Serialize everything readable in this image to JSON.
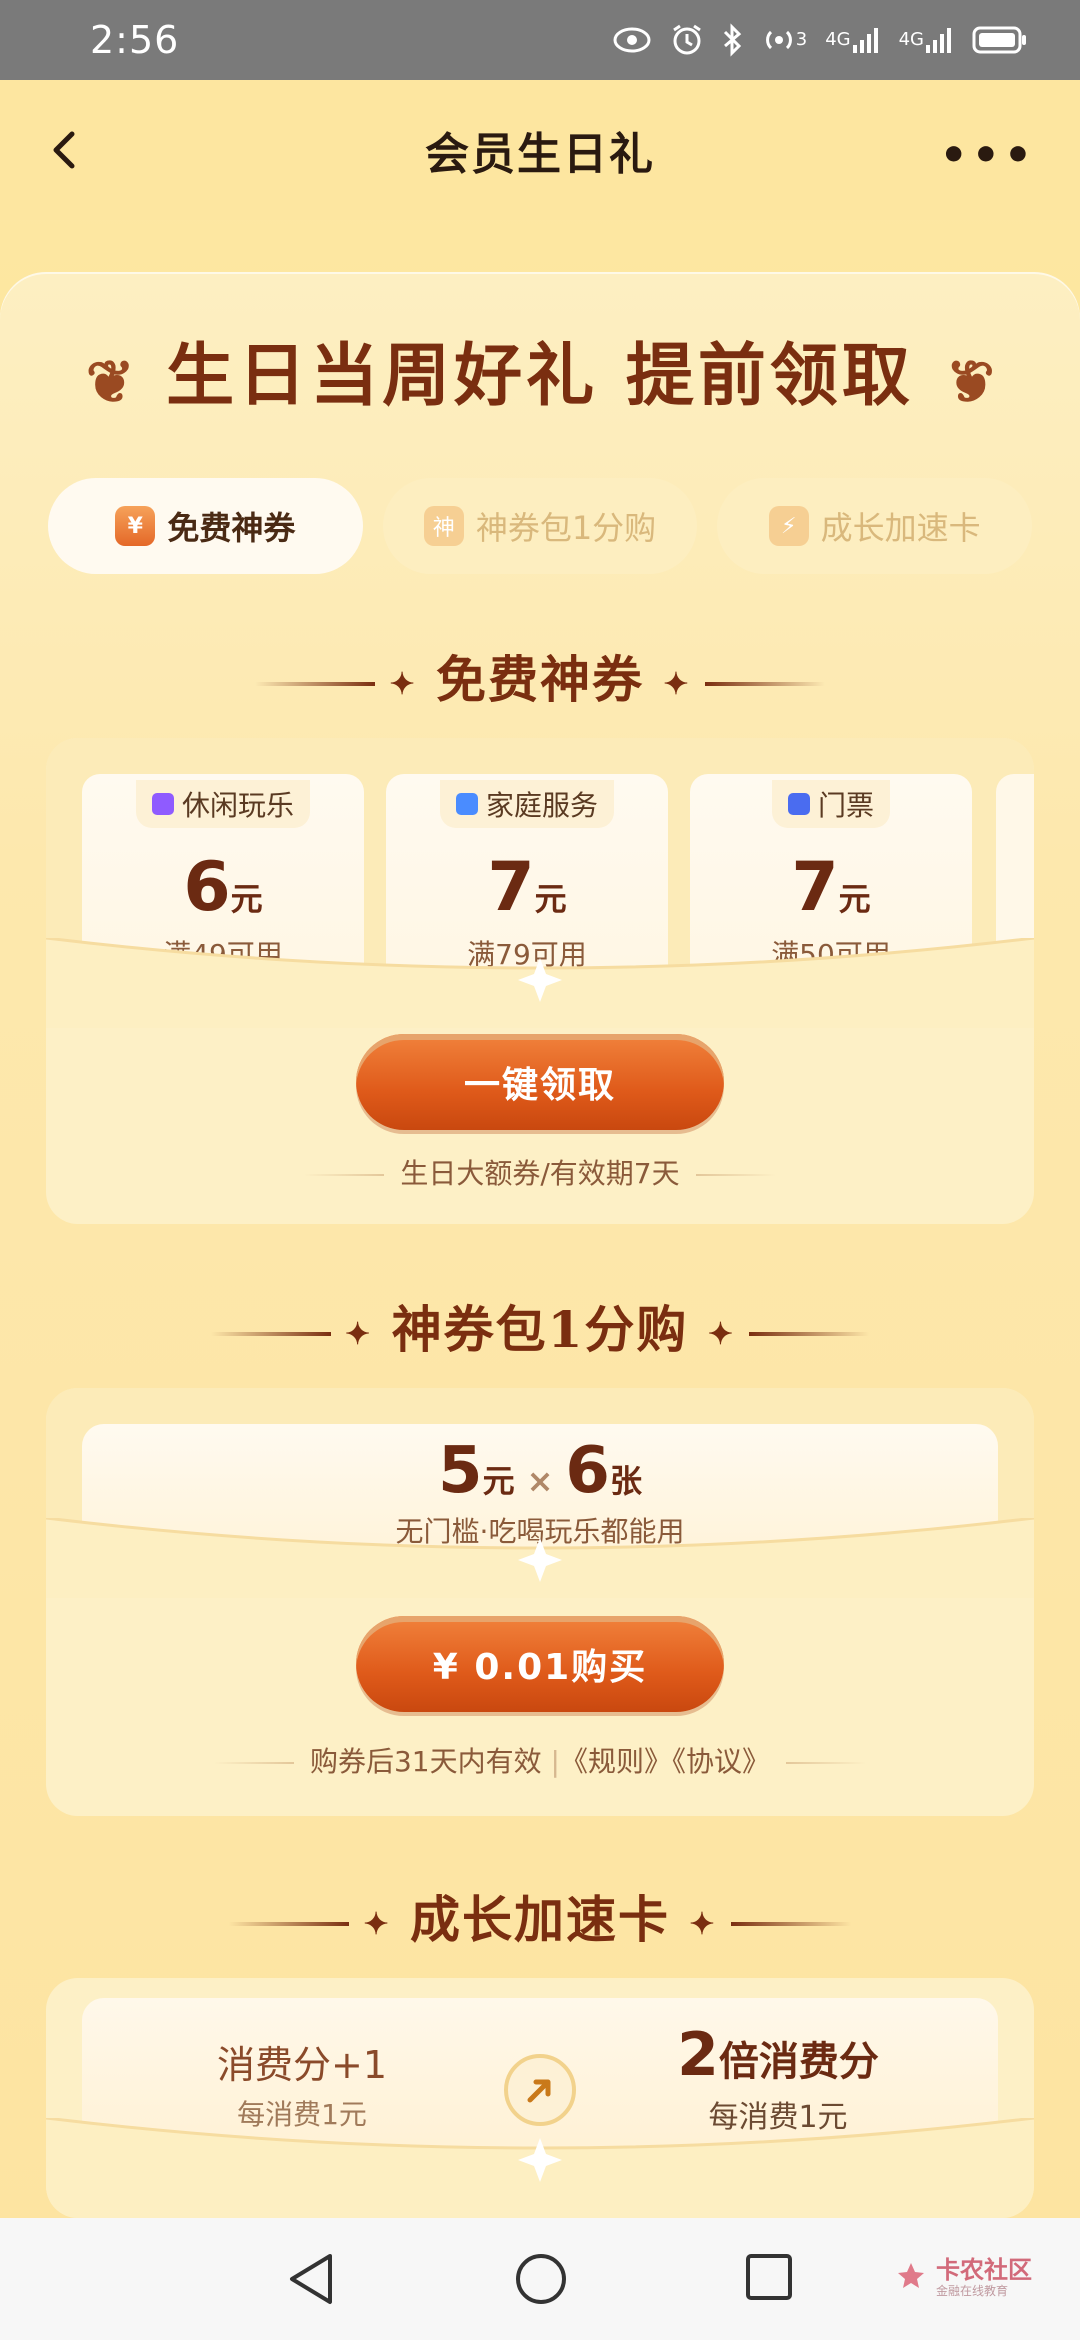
{
  "status_bar": {
    "time": "2:56",
    "network_a": "4G",
    "network_b": "4G",
    "signal_superscript": "3"
  },
  "nav": {
    "title": "会员生日礼"
  },
  "hero": {
    "title": "生日当周好礼 提前领取"
  },
  "tabs": [
    {
      "label": "免费神券",
      "icon": "yen-ticket-icon",
      "icon_glyph": "¥",
      "active": true
    },
    {
      "label": "神券包1分购",
      "icon": "shen-badge-icon",
      "icon_glyph": "神",
      "active": false
    },
    {
      "label": "成长加速卡",
      "icon": "lightning-icon",
      "icon_glyph": "⚡",
      "active": false
    }
  ],
  "free_coupons": {
    "heading": "免费神券",
    "coupons": [
      {
        "category": "休闲玩乐",
        "amount": "6",
        "unit": "元",
        "condition": "满49可用",
        "icon_color": "#8f5bff"
      },
      {
        "category": "家庭服务",
        "amount": "7",
        "unit": "元",
        "condition": "满79可用",
        "icon_color": "#4a8cff"
      },
      {
        "category": "门票",
        "amount": "7",
        "unit": "元",
        "condition": "满50可用",
        "icon_color": "#4a6cf0"
      }
    ],
    "cta_label": "一键领取",
    "note": "生日大额券/有效期7天"
  },
  "coupon_pack": {
    "heading": "神券包1分购",
    "amount": "5",
    "amount_unit": "元",
    "times": "×",
    "count": "6",
    "count_unit": "张",
    "desc": "无门槛·吃喝玩乐都能用",
    "cta_label": "¥ 0.01购买",
    "note_prefix": "购券后31天内有效",
    "note_sep": "|",
    "rules_link": "《规则》",
    "agreement_link": "《协议》"
  },
  "growth_card": {
    "heading": "成长加速卡",
    "left_title": "消费分+1",
    "left_sub": "每消费1元",
    "right_number": "2",
    "right_title": "倍消费分",
    "right_sub": "每消费1元"
  },
  "watermark": {
    "title": "卡农社区",
    "sub": "金融在线教育"
  },
  "colors": {
    "accent": "#df5a1a",
    "title_brown": "#7a2e10",
    "background": "#fde7a1"
  }
}
